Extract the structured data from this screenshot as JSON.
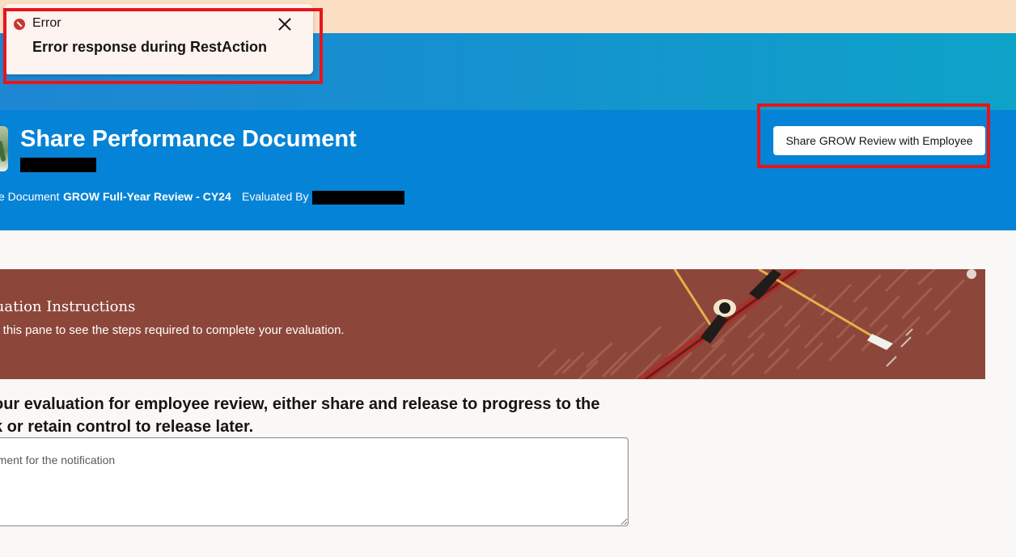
{
  "toast": {
    "label": "Error",
    "message": "Error response during RestAction",
    "status_color": "#c7372e"
  },
  "header": {
    "title": "Share Performance Document",
    "document_label": "e Document",
    "document_name": "GROW Full-Year Review - CY24",
    "evaluated_by_label": "Evaluated By",
    "share_button_label": "Share GROW Review with Employee",
    "accent_color": "#0583d6"
  },
  "instructions": {
    "title": "luation Instructions",
    "text": "k this pane to see the steps required to complete your evaluation.",
    "panel_color": "#8c473a"
  },
  "form": {
    "prompt_line1": "our evaluation for employee review, either share and release to progress to the",
    "prompt_line2": "k or retain control to release later.",
    "comment_placeholder": "mment for the notification"
  },
  "highlight_color": "#e8141b"
}
